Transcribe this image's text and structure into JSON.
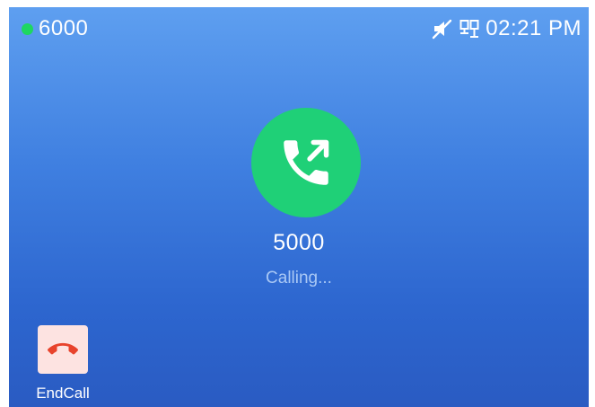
{
  "status_bar": {
    "account": "6000",
    "registration_color": "#1ed760",
    "icons": [
      "muted-speaker-icon",
      "network-icon"
    ],
    "time": "02:21 PM"
  },
  "call": {
    "icon": "outgoing-call-icon",
    "callee": "5000",
    "status": "Calling...",
    "accent_color": "#1fd077"
  },
  "softkeys": {
    "end_call": {
      "icon": "end-call-icon",
      "label": "EndCall",
      "color": "#e8432c"
    }
  }
}
